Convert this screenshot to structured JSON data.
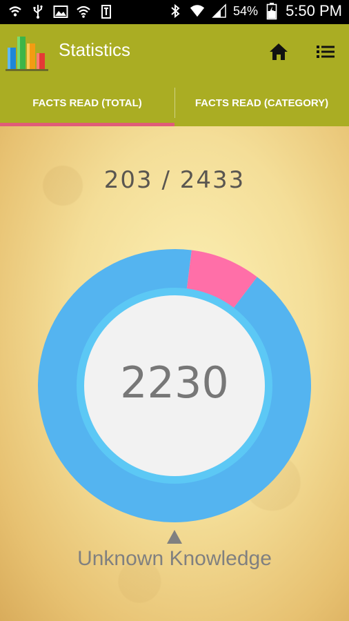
{
  "status_bar": {
    "battery": "54%",
    "time": "5:50 PM"
  },
  "app_bar": {
    "title": "Statistics"
  },
  "tabs": [
    {
      "label": "FACTS READ (TOTAL)",
      "selected": true
    },
    {
      "label": "FACTS READ (CATEGORY)",
      "selected": false
    }
  ],
  "stats": {
    "ratio_text": "203 / 2433",
    "center_value": "2230",
    "selected_segment_label": "Unknown Knowledge"
  },
  "chart_data": {
    "type": "pie",
    "slices": [
      {
        "label": "Unknown Knowledge",
        "value": 2230,
        "color": "#54B4F0"
      },
      {
        "value": 203,
        "color": "#FF6FA8"
      }
    ],
    "total": 2433
  },
  "colors": {
    "app_bar": "#AAAD23",
    "tab_indicator": "#E05C78",
    "unknown_segment": "#54B4F0",
    "read_segment": "#FF6FA8",
    "inner_ring": "#5CC8F5",
    "center_fill": "#F2F2F2"
  },
  "icons": {
    "home": "home-icon",
    "menu": "list-menu-icon"
  }
}
